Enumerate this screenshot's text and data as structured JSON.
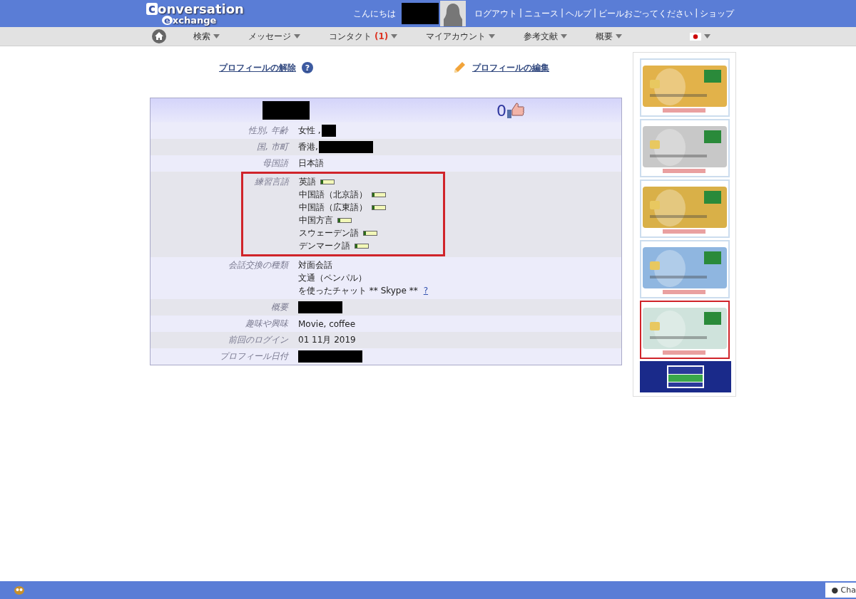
{
  "logo": {
    "initial_1": "c",
    "rest_1": "onversation",
    "initial_2": "e",
    "rest_2": "xchange"
  },
  "header": {
    "greeting": "こんにちは",
    "user_redacted": true,
    "separator": "|",
    "links": [
      "ログアウト",
      "ニュース",
      "ヘルプ",
      "ビールおごってください",
      "ショップ"
    ]
  },
  "nav": {
    "items": [
      {
        "label": "検索"
      },
      {
        "label": "メッセージ"
      },
      {
        "label": "コンタクト",
        "count": "(1)"
      },
      {
        "label": "マイアカウント"
      },
      {
        "label": "参考文献"
      },
      {
        "label": "概要"
      }
    ]
  },
  "actions": [
    {
      "kind": "help",
      "label": "プロフィールの解除",
      "icon_text": "?"
    },
    {
      "kind": "edit",
      "label": "プロフィールの編集"
    }
  ],
  "profile": {
    "name_redacted": true,
    "likes": "0",
    "rows": [
      {
        "kind": "text",
        "label": "性別, 年齢",
        "value": "女性 ,",
        "redacted": true
      },
      {
        "kind": "text",
        "label": "国, 市町",
        "value": "香港,",
        "redacted": true
      },
      {
        "kind": "text",
        "label": "母国語",
        "value": "日本語",
        "redacted": false
      },
      {
        "kind": "languages",
        "label": "練習言語",
        "highlighted": true,
        "languages": [
          {
            "name": "英語",
            "level": 0.15
          },
          {
            "name": "中国語（北京語）",
            "level": 0.15
          },
          {
            "name": "中国語（広東語）",
            "level": 0.15
          },
          {
            "name": "中国方言",
            "level": 0.15
          },
          {
            "name": "スウェーデン語",
            "level": 0.15
          },
          {
            "name": "デンマーク語",
            "level": 0.15
          }
        ]
      },
      {
        "kind": "lines",
        "label": "会話交換の種類",
        "lines": [
          "対面会話",
          "文通（ペンパル）",
          "を使ったチャット ** Skype **"
        ],
        "help": "?"
      },
      {
        "kind": "text",
        "label": "概要",
        "redacted": true
      },
      {
        "kind": "text",
        "label": "趣味や興味",
        "value": "Movie, coffee",
        "redacted": false
      },
      {
        "kind": "text",
        "label": "前回のログイン",
        "value": "01 11月 2019",
        "redacted": false
      },
      {
        "kind": "text",
        "label": "プロフィール日付",
        "redacted": true
      }
    ]
  },
  "ad": {
    "cards": [
      {
        "color": "#e2b24a",
        "selected": false
      },
      {
        "color": "#c8c8c8",
        "selected": false
      },
      {
        "color": "#d9b048",
        "selected": false
      },
      {
        "color": "#8fb6e0",
        "selected": false
      },
      {
        "color": "#cfe3dc",
        "selected": true
      }
    ]
  },
  "status_bar": {
    "dot": "●",
    "chat": "Cha"
  }
}
